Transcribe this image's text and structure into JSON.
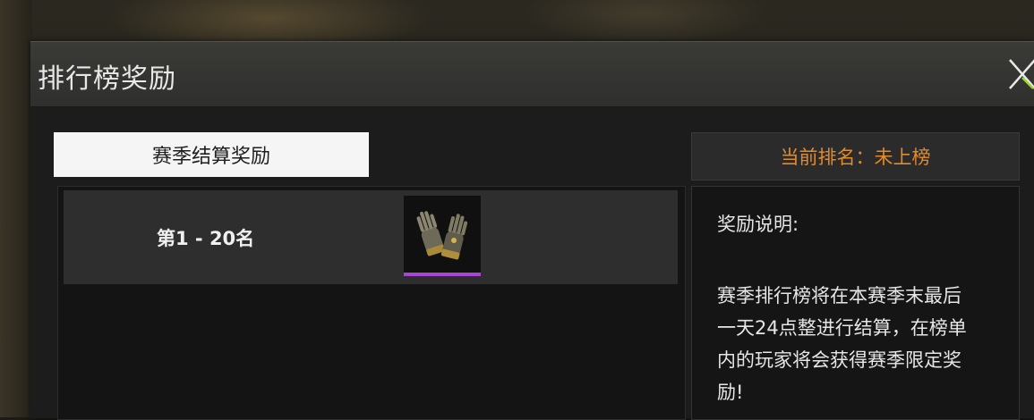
{
  "dialog": {
    "title": "排行榜奖励",
    "close_icon": "close-x-icon"
  },
  "tabs": [
    {
      "label": "赛季结算奖励",
      "active": true
    }
  ],
  "rewards": [
    {
      "rank": "第1 - 20名",
      "item_icon": "gloves-icon",
      "rarity_color": "#a845d6"
    }
  ],
  "status": {
    "current_rank": "当前排名：未上榜",
    "color": "#e38a2a"
  },
  "description": {
    "title": "奖励说明:",
    "text": "赛季排行榜将在本赛季末最后一天24点整进行结算，在榜单内的玩家将会获得赛季限定奖励!"
  }
}
